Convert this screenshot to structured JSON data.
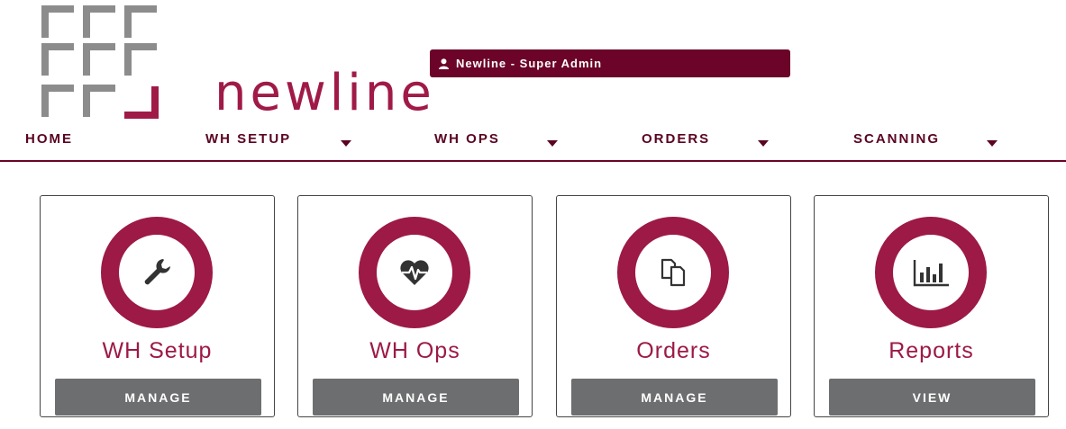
{
  "brand": {
    "logo_text": "newline",
    "color": "#a01a48",
    "mark_color": "#8c8c8c"
  },
  "user": {
    "icon": "user-icon",
    "label": "Newline - Super Admin",
    "badge_color": "#6b0428"
  },
  "nav": {
    "items": [
      {
        "label": "HOME",
        "has_dropdown": false
      },
      {
        "label": "WH SETUP",
        "has_dropdown": true
      },
      {
        "label": "WH OPS",
        "has_dropdown": true
      },
      {
        "label": "ORDERS",
        "has_dropdown": true
      },
      {
        "label": "SCANNING",
        "has_dropdown": true
      }
    ]
  },
  "cards": [
    {
      "title": "WH Setup",
      "icon": "wrench-icon",
      "button": "MANAGE"
    },
    {
      "title": "WH Ops",
      "icon": "heart-pulse-icon",
      "button": "MANAGE"
    },
    {
      "title": "Orders",
      "icon": "copy-documents-icon",
      "button": "MANAGE"
    },
    {
      "title": "Reports",
      "icon": "bar-chart-icon",
      "button": "VIEW"
    }
  ],
  "colors": {
    "accent": "#9c1a45",
    "button": "#6d6e70",
    "nav_text": "#5a0422"
  }
}
